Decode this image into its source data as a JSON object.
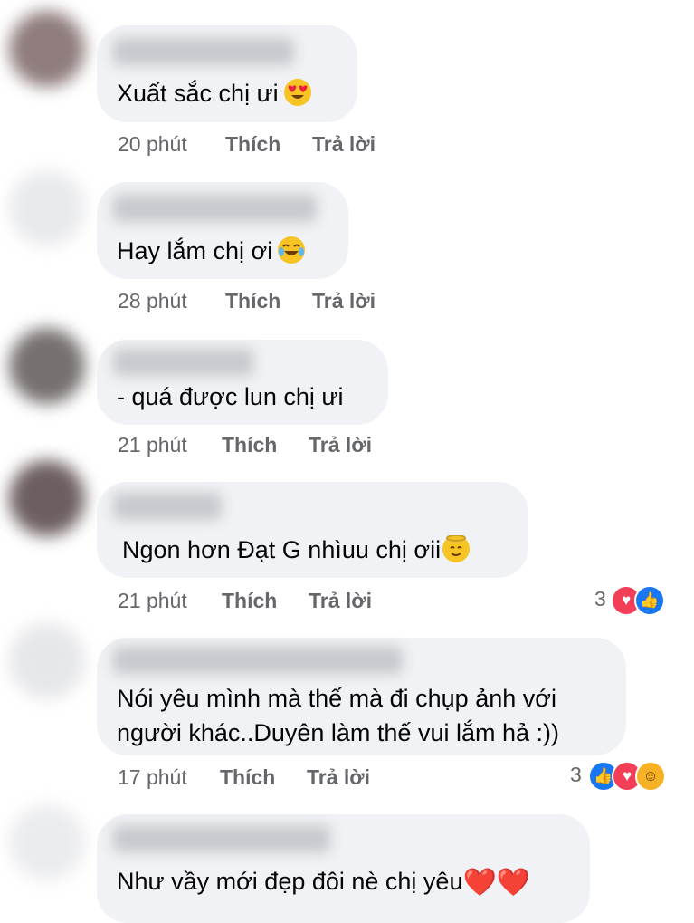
{
  "colors": {
    "bubble": "#f0f2f5",
    "meta": "#65676b",
    "like": "#1877f2",
    "love": "#f33e58",
    "haha": "#f7b125"
  },
  "comments": [
    {
      "text": "Xuất sắc chị ưi",
      "time": "20 phút",
      "like": "Thích",
      "reply": "Trả lời",
      "emoji": "heart-eyes-emoji"
    },
    {
      "text": "Hay lắm chị ơi",
      "time": "28 phút",
      "like": "Thích",
      "reply": "Trả lời",
      "emoji": "tears-of-joy-emoji"
    },
    {
      "text": "- quá được lun chị ưi",
      "time": "21 phút",
      "like": "Thích",
      "reply": "Trả lời"
    },
    {
      "text": "Ngon hơn Đạt G nhìuu chị ơii",
      "time": "21 phút",
      "like": "Thích",
      "reply": "Trả lời",
      "emoji": "angel-emoji",
      "reaction_count": "3",
      "reactions": [
        "love",
        "like"
      ]
    },
    {
      "text_line1": "Nói yêu mình mà thế mà đi chụp ảnh với",
      "text_line2": "người khác..Duyên làm thế vui lắm hả :))",
      "time": "17 phút",
      "like": "Thích",
      "reply": "Trả lời",
      "reaction_count": "3",
      "reactions": [
        "like",
        "love",
        "haha"
      ]
    },
    {
      "text": "Như vầy mới đẹp đôi nè chị yêu",
      "hearts": "❤️❤️"
    }
  ]
}
